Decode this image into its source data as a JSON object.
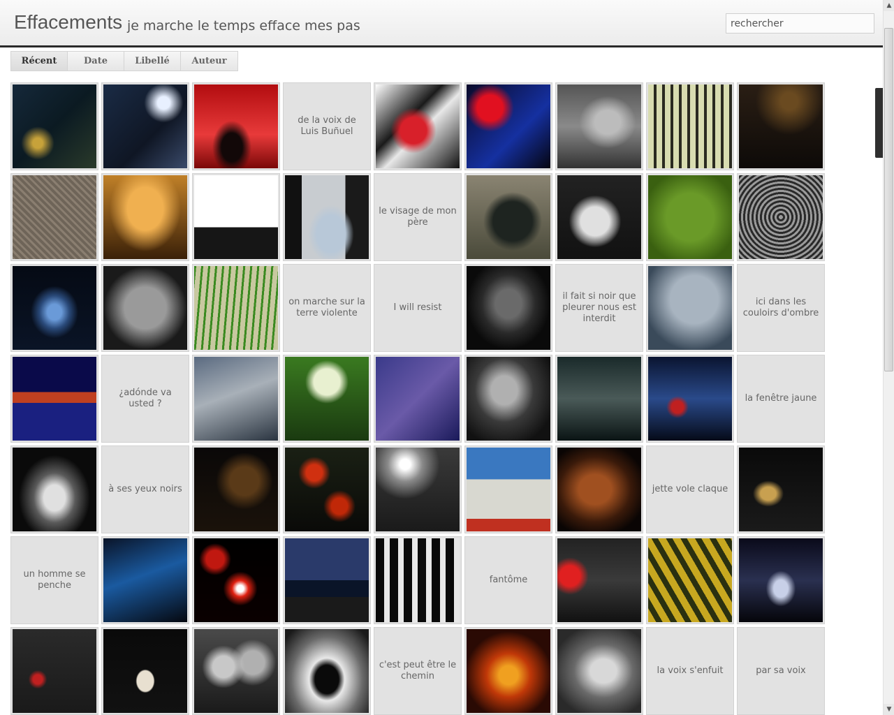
{
  "header": {
    "title": "Effacements",
    "tagline": "je marche le temps efface mes pas",
    "search_placeholder": "rechercher"
  },
  "tabs": [
    {
      "label": "Récent",
      "active": true
    },
    {
      "label": "Date",
      "active": false
    },
    {
      "label": "Libellé",
      "active": false
    },
    {
      "label": "Auteur",
      "active": false
    }
  ],
  "grid": {
    "columns": 9,
    "items": [
      {
        "type": "image",
        "bg": "radial-gradient(circle at 30% 70%, #c7a23a 0 6%, transparent 20%), linear-gradient(135deg, #15283a, #0b1a22 50%, #2a3a2a)"
      },
      {
        "type": "image",
        "bg": "radial-gradient(circle at 72% 22%, #e8f0ff 0 7%, transparent 22%), linear-gradient(135deg, #1a2b45, #0f1624 60%, #3a4a6a)"
      },
      {
        "type": "image",
        "bg": "radial-gradient(ellipse at 45% 75%, #120808 0 16%, transparent 30%), linear-gradient(#b20d10, #e83a3a 60%, #7a0808)"
      },
      {
        "type": "text",
        "label": "de la voix de Luis Buñuel"
      },
      {
        "type": "image",
        "bg": "radial-gradient(circle at 45% 55%, #d8202a 0 20%, transparent 35%), linear-gradient(135deg, #ffffff, #1a1a1a 40%, #e8e8e8 55%, #111)"
      },
      {
        "type": "image",
        "bg": "radial-gradient(circle at 28% 28%, #e11020 0 15%, transparent 28%), linear-gradient(135deg, #0a0a2a, #1530a0 60%, #050510)"
      },
      {
        "type": "image",
        "bg": "radial-gradient(ellipse at 60% 45%, #bcbcbc 0 18%, transparent 40%), linear-gradient(#555, #8a8a8a 50%, #333)"
      },
      {
        "type": "image",
        "bg": "repeating-linear-gradient(90deg, #d8dcb0 0 8px, #2a2a20 8px 12px), linear-gradient(#ccd0a0, #555)"
      },
      {
        "type": "image",
        "bg": "radial-gradient(circle at 60% 20%, #6a4a20 0 10%, transparent 40%), linear-gradient(#2a1e14, #0d0a08)"
      },
      {
        "type": "image",
        "bg": "repeating-linear-gradient(45deg, #8a7e70 0 3px, #6e6458 3px 7px), linear-gradient(#9a8e80, #5a5048)"
      },
      {
        "type": "image",
        "bg": "radial-gradient(ellipse at 50% 40%, #f0b050 0 30%, transparent 60%), linear-gradient(#c08028, #3a2008)"
      },
      {
        "type": "image",
        "bg": "linear-gradient(#ffffff 0 62%, #161616 62%)"
      },
      {
        "type": "image",
        "bg": "radial-gradient(ellipse at 55% 70%, #b8c8d8 0 22%, transparent 35%), linear-gradient(90deg, #111 0 20%, #c8ccd0 20% 72%, #1a1a1a 72%)"
      },
      {
        "type": "text",
        "label": "le visage de mon père"
      },
      {
        "type": "image",
        "bg": "radial-gradient(ellipse at 55% 55%, #1e2420 0 30%, transparent 45%), linear-gradient(#8a8472, #4a4a3a)"
      },
      {
        "type": "image",
        "bg": "radial-gradient(ellipse at 45% 55%, #e0e0e0 0 22%, #7a7a7a 32%, transparent 40%), linear-gradient(#222, #111)"
      },
      {
        "type": "image",
        "bg": "radial-gradient(circle at 50% 50%, #6a9a28 0 40%, #3a6010 80%)"
      },
      {
        "type": "image",
        "bg": "repeating-radial-gradient(circle at 50% 50%, #9a9a9a 0 3px, #2a2a2a 3px 6px)"
      },
      {
        "type": "image",
        "bg": "radial-gradient(ellipse at 50% 55%, #6a9ad8 0 12%, #2a4a7a 25%, transparent 40%), linear-gradient(#050a14, #0a1426)"
      },
      {
        "type": "image",
        "bg": "radial-gradient(circle at 50% 50%, #9a9a9a 0 35%, #1a1a1a 70%)"
      },
      {
        "type": "image",
        "bg": "repeating-linear-gradient(95deg, #3a8a20 0 3px, #c8c8a0 3px 10px), linear-gradient(#d0c8a8, #8a6040)"
      },
      {
        "type": "text",
        "label": "on marche sur la terre violente"
      },
      {
        "type": "text",
        "label": "I will resist"
      },
      {
        "type": "image",
        "bg": "radial-gradient(ellipse at 50% 45%, #6a6a6a 0 22%, #2a2a2a 45%, #0a0a0a 70%)"
      },
      {
        "type": "text",
        "label": "il fait si noir que pleurer nous est interdit"
      },
      {
        "type": "image",
        "bg": "radial-gradient(circle at 55% 40%, #a8b4c0 0 35%, #3a4a5a 75%)"
      },
      {
        "type": "text",
        "label": "ici dans les couloirs d'ombre"
      },
      {
        "type": "image",
        "bg": "linear-gradient(#0a0a4a 0 42%, #c04020 42% 55%, #1a2080 55%)"
      },
      {
        "type": "text",
        "label": "¿adónde va usted ?"
      },
      {
        "type": "image",
        "bg": "linear-gradient(160deg, #5a6a80, #a8b0b8 45%, #2a3440)"
      },
      {
        "type": "image",
        "bg": "radial-gradient(circle at 50% 30%, #e8f0d0 0 18%, transparent 30%), linear-gradient(#3a7a20, #1a3a10)"
      },
      {
        "type": "image",
        "bg": "linear-gradient(135deg, #3a3a8a, #6a5aa8 50%, #1a1a5a)"
      },
      {
        "type": "image",
        "bg": "radial-gradient(ellipse at 45% 40%, #b0b0b0 0 20%, #3a3a3a 45%, #111 80%)"
      },
      {
        "type": "image",
        "bg": "linear-gradient(#1a2a2a, #4a5a58 50%, #0a1414)"
      },
      {
        "type": "image",
        "bg": "radial-gradient(circle at 35% 60%, #c02020 0 8%, transparent 15%), linear-gradient(#0a1430, #2a4a8a 50%, #050a18)"
      },
      {
        "type": "text",
        "label": "la fenêtre jaune"
      },
      {
        "type": "image",
        "bg": "radial-gradient(ellipse at 50% 60%, #e0e0e0 0 18%, #5a5a5a 35%, #0a0a0a 60%)"
      },
      {
        "type": "text",
        "label": "à ses yeux noirs"
      },
      {
        "type": "image",
        "bg": "radial-gradient(circle at 60% 40%, #5a3a18 0 20%, transparent 40%), linear-gradient(#0a0808, #1a120a)"
      },
      {
        "type": "image",
        "bg": "radial-gradient(circle at 35% 30%, #d03010 0 10%, transparent 20%), radial-gradient(circle at 65% 70%, #c02808 0 10%, transparent 20%), linear-gradient(#1a2014, #0a0a08)"
      },
      {
        "type": "image",
        "bg": "radial-gradient(circle at 35% 20%, #ffffff 0 6%, #8a8a8a 20%, transparent 40%), linear-gradient(#3a3a3a, #1a1a1a)"
      },
      {
        "type": "image",
        "bg": "linear-gradient(#3a78c0 0 38%, #d8d8d0 38% 85%, #c03020 85%)"
      },
      {
        "type": "image",
        "bg": "radial-gradient(ellipse at 45% 50%, #a05020 0 25%, #3a1a0a 55%, #0a0504 80%)"
      },
      {
        "type": "text",
        "label": "jette vole claque"
      },
      {
        "type": "image",
        "bg": "radial-gradient(ellipse at 35% 55%, #c8a050 0 10%, transparent 20%), linear-gradient(#0a0a0a, #1a1a1a)"
      },
      {
        "type": "text",
        "label": "un homme se penche"
      },
      {
        "type": "image",
        "bg": "linear-gradient(160deg, #0a1428, #1a5aa0 45%, #05080f)"
      },
      {
        "type": "image",
        "bg": "radial-gradient(circle at 55% 60%, #ffffff 0 5%, #e02010 12%, transparent 25%), radial-gradient(circle at 25% 25%, #c01810 0 10%, transparent 18%), linear-gradient(#000, #0a0000)"
      },
      {
        "type": "image",
        "bg": "linear-gradient(#2a3a6a 0 50%, #0a1428 50% 70%, #1a1a1a 70%)"
      },
      {
        "type": "image",
        "bg": "repeating-linear-gradient(90deg, #0a0a0a 0 12px, #e8e8e8 12px 20px), linear-gradient(#fff, #000)"
      },
      {
        "type": "text",
        "label": "fantôme"
      },
      {
        "type": "image",
        "bg": "radial-gradient(circle at 15% 45%, #e02020 0 12%, transparent 22%), linear-gradient(#222, #3a3a3a 50%, #111)"
      },
      {
        "type": "image",
        "bg": "repeating-linear-gradient(60deg, #c8a820 0 10px, #2a3010 10px 18px), linear-gradient(#d0b030, #3a3a10)"
      },
      {
        "type": "image",
        "bg": "radial-gradient(ellipse at 50% 60%, #c8d0e8 0 12%, transparent 25%), linear-gradient(#0a0a1a, #2a3050 50%, #05050a)"
      },
      {
        "type": "image",
        "bg": "radial-gradient(circle at 30% 60%, #c02020 0 6%, transparent 12%), linear-gradient(#2a2a2a, #1a1a1a)"
      },
      {
        "type": "image",
        "bg": "radial-gradient(ellipse at 50% 62%, #e8e0d0 0 14%, transparent 16%), linear-gradient(#0a0a0a, #111)"
      },
      {
        "type": "image",
        "bg": "radial-gradient(circle at 35% 45%, #c8c8c8 0 15%, transparent 30%), radial-gradient(circle at 70% 40%, #b0b0b0 0 15%, transparent 30%), linear-gradient(#4a4a4a, #1a1a1a)"
      },
      {
        "type": "image",
        "bg": "radial-gradient(ellipse at 50% 60%, #0a0a0a 0 20%, #e8e8e8 30%, #6a6a6a 60%, #1a1a1a 90%)"
      },
      {
        "type": "text",
        "label": "c'est peut être le chemin"
      },
      {
        "type": "image",
        "bg": "radial-gradient(circle at 50% 55%, #f0a020 0 15%, #c03808 35%, #2a0a04 70%)"
      },
      {
        "type": "image",
        "bg": "radial-gradient(ellipse at 55% 50%, #d8d8d8 0 20%, #6a6a6a 45%, #2a2a2a 80%)"
      },
      {
        "type": "text",
        "label": "la voix s'enfuit"
      },
      {
        "type": "text",
        "label": "par sa voix"
      }
    ]
  }
}
